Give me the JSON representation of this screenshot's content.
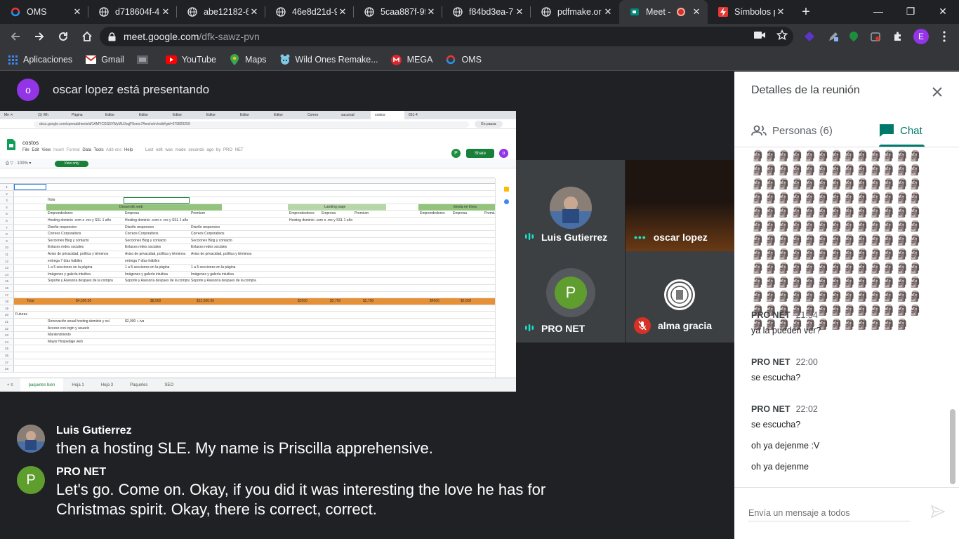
{
  "browser": {
    "tabs": [
      {
        "title": "OMS",
        "icon": "oms-icon",
        "color": "#e53935"
      },
      {
        "title": "d718604f-4",
        "icon": "globe-icon",
        "color": "#e8eaed"
      },
      {
        "title": "abe12182-6",
        "icon": "globe-icon",
        "color": "#e8eaed"
      },
      {
        "title": "46e8d21d-9",
        "icon": "globe-icon",
        "color": "#e8eaed"
      },
      {
        "title": "5caa887f-9f",
        "icon": "globe-icon",
        "color": "#e8eaed"
      },
      {
        "title": "f84bd3ea-7",
        "icon": "globe-icon",
        "color": "#e8eaed"
      },
      {
        "title": "pdfmake.or",
        "icon": "globe-icon",
        "color": "#e8eaed"
      },
      {
        "title": "Meet -",
        "icon": "meet-icon",
        "color": "#00897b"
      },
      {
        "title": "Símbolos p",
        "icon": "lightning-icon",
        "color": "#e53935"
      }
    ],
    "url_host": "meet.google.com",
    "url_path": "/dfk-sawz-pvn",
    "profile_letter": "E",
    "bookmarks": [
      {
        "label": "Aplicaciones",
        "icon": "apps-grid-icon"
      },
      {
        "label": "Gmail",
        "icon": "gmail-icon"
      },
      {
        "label": "",
        "icon": "bookmark-image-icon"
      },
      {
        "label": "YouTube",
        "icon": "youtube-icon"
      },
      {
        "label": "Maps",
        "icon": "maps-pin-icon"
      },
      {
        "label": "Wild Ones Remake...",
        "icon": "wildones-icon"
      },
      {
        "label": "MEGA",
        "icon": "mega-icon"
      },
      {
        "label": "OMS",
        "icon": "oms-icon"
      }
    ]
  },
  "meet": {
    "presenter_initial": "o",
    "presenter_text": "oscar lopez está presentando",
    "participants": [
      {
        "name": "Luis Gutierrez",
        "indicator": "speaking",
        "avatar": "photo"
      },
      {
        "name": "oscar lopez",
        "indicator": "more",
        "avatar": "video"
      },
      {
        "name": "PRO NET",
        "indicator": "speaking",
        "avatar": "P"
      },
      {
        "name": "alma gracia",
        "indicator": "muted",
        "avatar": "seal"
      }
    ],
    "captions": [
      {
        "speaker": "Luis Gutierrez",
        "text": "then a hosting SLE. My name is Priscilla apprehensive.",
        "avatar": "photo"
      },
      {
        "speaker": "PRO NET",
        "text": "Let's go. Come on. Okay, if you did it was interesting the love he has for Christmas spirit. Okay, there is correct, correct.",
        "avatar": "P"
      }
    ]
  },
  "panel": {
    "title": "Detalles de la reunión",
    "tab_people": "Personas (6)",
    "tab_chat": "Chat",
    "glyph_block": "🗿🗿🗿🗿🗿🗿🗿🗿🗿🗿🗿🗿🗿🗿🗿🗿🗿🗿🗿🗿🗿🗿🗿🗿🗿🗿🗿🗿🗿🗿🗿🗿🗿🗿🗿🗿🗿🗿🗿🗿🗿🗿🗿🗿🗿🗿🗿🗿🗿🗿🗿🗿🗿🗿🗿🗿🗿🗿🗿🗿🗿🗿🗿🗿🗿🗿🗿🗿🗿🗿🗿🗿🗿🗿🗿🗿🗿🗿🗿🗿🗿🗿🗿🗿🗿🗿🗿🗿🗿🗿🗿🗿🗿🗿🗿🗿🗿🗿🗿🗿🗿🗿🗿🗿🗿🗿🗿🗿🗿🗿🗿🗿🗿🗿🗿🗿🗿🗿🗿🗿🗿🗿🗿🗿🗿🗿🗿🗿🗿🗿🗿🗿🗿🗿🗿🗿🗿🗿🗿🗿🗿🗿🗿🗿🗿🗿🗿🗿🗿🗿🗿🗿🗿🗿🗿🗿🗿🗿🗿🗿🗿🗿🗿🗿🗿🗿🗿🗿",
    "messages": [
      {
        "sender": "PRO NET",
        "time": "21:54",
        "lines": [
          "ya la pueden ver?"
        ]
      },
      {
        "sender": "PRO NET",
        "time": "22:00",
        "lines": [
          "se escucha?"
        ]
      },
      {
        "sender": "PRO NET",
        "time": "22:02",
        "lines": [
          "se escucha?",
          "oh ya dejenme :V",
          "oh ya dejenme"
        ]
      }
    ],
    "composer_placeholder": "Envía un mensaje a todos"
  },
  "shared_screen": {
    "doc_title": "costos",
    "menu": [
      "File",
      "Edit",
      "View",
      "Insert",
      "Format",
      "Data",
      "Tools",
      "Add-ons",
      "Help"
    ],
    "last_edit": "Last edit was made seconds ago by PRO NET",
    "share_label": "Share",
    "view_only": "View only",
    "url": "docs.google.com/spreadsheets/d/1AMYCGS5VWyMUJxqjF5omc7Amchshv/edit#gid=679820259",
    "sheets": [
      "paquetes bien",
      "Hoja 1",
      "Hoja 3",
      "Paquetes",
      "SEO"
    ],
    "cells": {
      "hola": "Hola",
      "desarrollo_web": "Desarrollo web",
      "landing_page": "Landing page",
      "tienda": "tienda en línea",
      "emprendedores": "Emprendedores",
      "empresa": "Empresa",
      "premium": "Premium",
      "total": "Total",
      "total_values": [
        "$4,500.00",
        "$8,500",
        "$12,500.00",
        "$2500",
        "$2,700",
        "$2,700",
        "$4500",
        "$6,500"
      ],
      "futuras": "Futuras",
      "renovacion": "Renovación anual hosting dominio y ssl",
      "renovacion_price": "$2,000 + iva",
      "acceso": "Acceso con login y usuario",
      "mantenimiento": "Mantenimiento",
      "mayor_hospedaje": "Mayor Hospedaje web",
      "col_a_rows": [
        "Hosting dominio .com o .mx y SSL 1 año",
        "Diseño responsivo",
        "Correos Corporativos",
        "Secciones Blog y contacto",
        "Enlaces redes sociales",
        "Aviso de privacidad, política y términos",
        "entrega 7 días hábiles",
        "1 a 5 secciones en la página",
        "Imágenes y galería intuitiva",
        "Soporte y Asesoría despues de la compra"
      ]
    }
  },
  "colors": {
    "meet_green": "#00796b",
    "pro_net_avatar": "#5f9e2e",
    "oscar_avatar": "#9334e6",
    "mic_muted": "#d93025"
  }
}
